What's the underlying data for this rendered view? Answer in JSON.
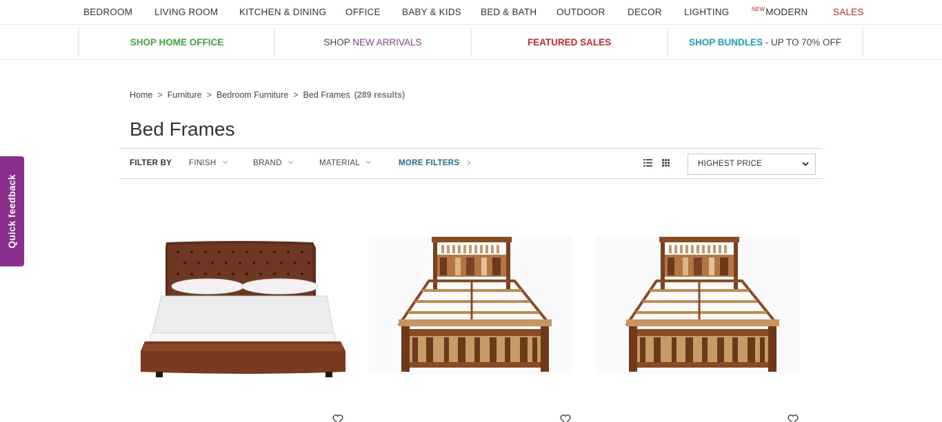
{
  "topnav": {
    "items": [
      {
        "label": "BEDROOM"
      },
      {
        "label": "LIVING ROOM"
      },
      {
        "label": "KITCHEN & DINING"
      },
      {
        "label": "OFFICE"
      },
      {
        "label": "BABY & KIDS"
      },
      {
        "label": "BED & BATH"
      },
      {
        "label": "OUTDOOR"
      },
      {
        "label": "DECOR"
      },
      {
        "label": "LIGHTING"
      },
      {
        "label": "MODERN",
        "tag": "NEW"
      },
      {
        "label": "SALES"
      }
    ]
  },
  "promos": [
    {
      "label": "SHOP HOME OFFICE"
    },
    {
      "prefix": "SHOP",
      "label": "NEW ARRIVALS"
    },
    {
      "label": "FEATURED SALES"
    },
    {
      "label": "SHOP BUNDLES",
      "suffix": "- UP TO 70% OFF"
    }
  ],
  "breadcrumb": {
    "items": [
      "Home",
      "Furniture",
      "Bedroom Furniture",
      "Bed Frames"
    ],
    "separator": ">",
    "count": "(289 results)"
  },
  "page_title": "Bed Frames",
  "filters": {
    "label": "FILTER BY",
    "options": [
      "FINISH",
      "BRAND",
      "MATERIAL"
    ],
    "more": "MORE FILTERS",
    "sort": {
      "selected": "HIGHEST PRICE"
    }
  },
  "feedback": {
    "label": "Quick feedback"
  },
  "products": [
    {
      "image": "leather-tufted-bed"
    },
    {
      "image": "wood-slat-bed"
    },
    {
      "image": "wood-slat-bed"
    }
  ],
  "colors": {
    "sales_red": "#d0232a",
    "home_office_green": "#3aa935",
    "new_arrivals_purple": "#8e3c8e",
    "bundles_teal": "#1a9fc7",
    "feedback_purple": "#8b2e8c",
    "more_filters_blue": "#1d6e8c"
  },
  "icons": {
    "list_view": "list-view-icon",
    "grid_view": "grid-view-icon",
    "favorite": "heart-icon",
    "dropdown": "chevron-down-icon"
  }
}
